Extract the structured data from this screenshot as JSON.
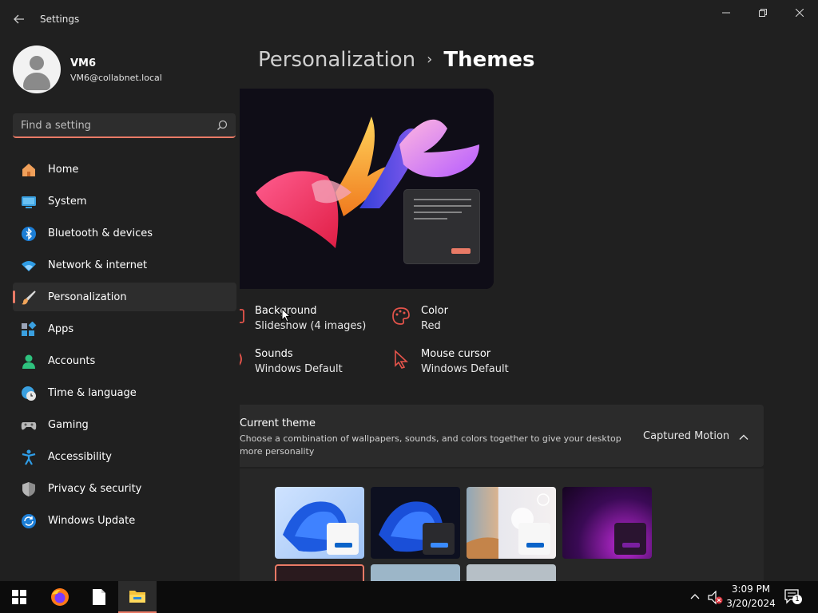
{
  "window": {
    "title": "Settings",
    "accent_color": "#e97a66"
  },
  "user": {
    "name": "VM6",
    "email": "VM6@collabnet.local"
  },
  "search": {
    "placeholder": "Find a setting"
  },
  "sidebar": {
    "selected": "Personalization",
    "items": [
      {
        "label": "Home",
        "icon": "home-icon"
      },
      {
        "label": "System",
        "icon": "monitor-icon"
      },
      {
        "label": "Bluetooth & devices",
        "icon": "bluetooth-icon"
      },
      {
        "label": "Network & internet",
        "icon": "wifi-icon"
      },
      {
        "label": "Personalization",
        "icon": "brush-icon"
      },
      {
        "label": "Apps",
        "icon": "apps-icon"
      },
      {
        "label": "Accounts",
        "icon": "person-icon"
      },
      {
        "label": "Time & language",
        "icon": "globe-clock-icon"
      },
      {
        "label": "Gaming",
        "icon": "gamepad-icon"
      },
      {
        "label": "Accessibility",
        "icon": "accessibility-icon"
      },
      {
        "label": "Privacy & security",
        "icon": "shield-icon"
      },
      {
        "label": "Windows Update",
        "icon": "update-icon"
      }
    ]
  },
  "breadcrumb": {
    "parent": "Personalization",
    "separator": "›",
    "current": "Themes"
  },
  "theme_properties": [
    {
      "title": "Background",
      "value": "Slideshow (4 images)",
      "icon": "image-icon"
    },
    {
      "title": "Color",
      "value": "Red",
      "icon": "palette-icon"
    },
    {
      "title": "Sounds",
      "value": "Windows Default",
      "icon": "speaker-icon"
    },
    {
      "title": "Mouse cursor",
      "value": "Windows Default",
      "icon": "cursor-icon"
    }
  ],
  "current_theme": {
    "title": "Current theme",
    "description": "Choose a combination of wallpapers, sounds, and colors together to give your desktop more personality",
    "value": "Captured Motion"
  },
  "taskbar": {
    "apps": [
      "start-icon",
      "firefox-icon",
      "file-icon",
      "file-explorer-icon"
    ],
    "time": "3:09 PM",
    "date": "3/20/2024",
    "notification_count": "1"
  }
}
